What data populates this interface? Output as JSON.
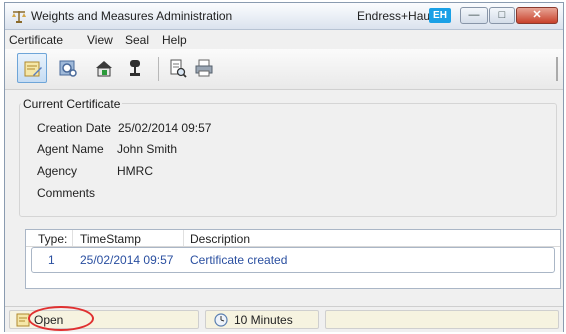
{
  "window": {
    "title": "Weights and Measures Administration",
    "brand": "Endress+Hauser",
    "brand_logo": "EH"
  },
  "menu": [
    "Certificate",
    "View",
    "Seal",
    "Help"
  ],
  "toolbar": {
    "icons": [
      "certificate-edit-icon",
      "gears-icon",
      "house-lock-icon",
      "seal-icon",
      "print-preview-icon",
      "printer-icon"
    ]
  },
  "certificate": {
    "group_title": "Current Certificate",
    "creation_date_label": "Creation Date",
    "creation_date_value": "25/02/2014 09:57",
    "agent_name_label": "Agent Name",
    "agent_name_value": "John Smith",
    "agency_label": "Agency",
    "agency_value": "HMRC",
    "comments_label": "Comments",
    "comments_value": ""
  },
  "history": {
    "columns": [
      "Type:",
      "TimeStamp",
      "Description"
    ],
    "rows": [
      {
        "type": "1",
        "timestamp": "25/02/2014 09:57",
        "description": "Certificate created"
      }
    ]
  },
  "status": {
    "state": "Open",
    "timer": "10 Minutes",
    "highlight_color": "#e03030"
  }
}
